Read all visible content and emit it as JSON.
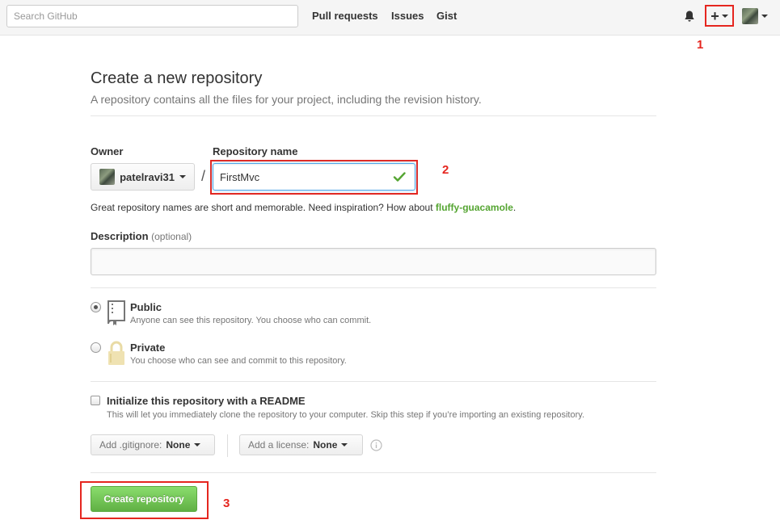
{
  "header": {
    "search_placeholder": "Search GitHub",
    "nav": [
      "Pull requests",
      "Issues",
      "Gist"
    ],
    "plus_label": "+"
  },
  "annotations": [
    "1",
    "2",
    "3"
  ],
  "page": {
    "title": "Create a new repository",
    "subtitle": "A repository contains all the files for your project, including the revision history."
  },
  "form": {
    "owner_label": "Owner",
    "owner_value": "patelravi31",
    "separator": "/",
    "repo_label": "Repository name",
    "repo_value": "FirstMvc",
    "hint_prefix": "Great repository names are short and memorable. Need inspiration? How about ",
    "hint_suggestion": "fluffy-guacamole",
    "hint_suffix": ".",
    "description_label": "Description",
    "description_optional": "(optional)",
    "description_value": ""
  },
  "visibility": {
    "selected": "public",
    "public": {
      "title": "Public",
      "note": "Anyone can see this repository. You choose who can commit."
    },
    "private": {
      "title": "Private",
      "note": "You choose who can see and commit to this repository."
    }
  },
  "readme": {
    "checked": false,
    "title": "Initialize this repository with a README",
    "note": "This will let you immediately clone the repository to your computer. Skip this step if you’re importing an existing repository."
  },
  "gitignore": {
    "label": "Add .gitignore:",
    "value": "None"
  },
  "license": {
    "label": "Add a license:",
    "value": "None"
  },
  "submit_label": "Create repository",
  "colors": {
    "annotation": "#e5261f",
    "primary_button": "#60b044",
    "suggestion": "#55a532",
    "focus": "#51a7e8"
  },
  "icons": [
    "bell-icon",
    "plus-icon",
    "caret-down-icon",
    "avatar",
    "check-icon",
    "repo-book-icon",
    "lock-icon",
    "info-icon"
  ]
}
